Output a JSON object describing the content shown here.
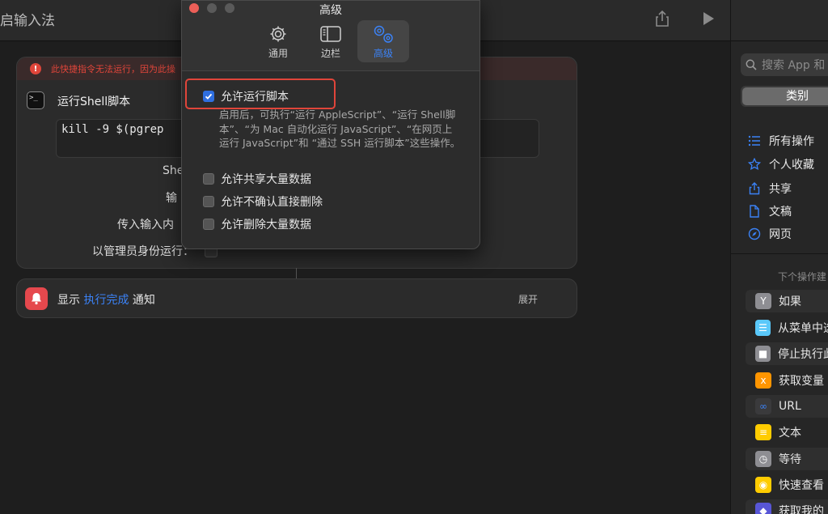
{
  "window": {
    "title": "启输入法"
  },
  "toolbar": {
    "share_icon": "share-icon",
    "run_icon": "play-icon"
  },
  "error": {
    "message": "此快捷指令无法运行，因为此操"
  },
  "shell_action": {
    "title": "运行Shell脚本",
    "code": "kill -9 $(pgrep",
    "labels": {
      "shell": "Shel",
      "input": "输",
      "pass_input": "传入输入内",
      "run_as_admin": "以管理员身份运行："
    }
  },
  "notify_action": {
    "prefix": "显示",
    "variable": "执行完成",
    "suffix": "通知",
    "expand": "展开"
  },
  "popover": {
    "title": "高级",
    "tabs": [
      {
        "label": "通用",
        "icon": "gear-icon"
      },
      {
        "label": "边栏",
        "icon": "sidebar-icon"
      },
      {
        "label": "高级",
        "icon": "gears-icon",
        "active": true
      }
    ],
    "options": [
      {
        "label": "允许运行脚本",
        "checked": true
      },
      {
        "label": "允许共享大量数据",
        "checked": false
      },
      {
        "label": "允许不确认直接删除",
        "checked": false
      },
      {
        "label": "允许删除大量数据",
        "checked": false
      }
    ],
    "description": "启用后，可执行“运行 AppleScript”、“运行 Shell脚本”、“为 Mac 自动化运行 JavaScript”、“在网页上运行 JavaScript”和 “通过 SSH 运行脚本”这些操作。"
  },
  "sidebar": {
    "search_placeholder": "搜索 App 和",
    "segment_active": "类别",
    "categories": [
      {
        "label": "所有操作",
        "icon": "list-icon"
      },
      {
        "label": "个人收藏",
        "icon": "star-icon"
      },
      {
        "label": "共享",
        "icon": "share-icon"
      },
      {
        "label": "文稿",
        "icon": "document-icon"
      },
      {
        "label": "网页",
        "icon": "compass-icon"
      }
    ],
    "suggestions_header": "下个操作建",
    "suggestions": [
      {
        "label": "如果",
        "icon": "branch-icon",
        "color": "#8e8e93"
      },
      {
        "label": "从菜单中选",
        "icon": "menu-icon",
        "color": "#5ac8fa"
      },
      {
        "label": "停止执行此",
        "icon": "stop-icon",
        "color": "#8e8e93"
      },
      {
        "label": "获取变量",
        "icon": "variable-icon",
        "color": "#ff9500"
      },
      {
        "label": "URL",
        "icon": "link-icon",
        "color": "#3a3a3c"
      },
      {
        "label": "文本",
        "icon": "text-icon",
        "color": "#ffcc00"
      },
      {
        "label": "等待",
        "icon": "clock-icon",
        "color": "#8e8e93"
      },
      {
        "label": "快速查看",
        "icon": "eye-icon",
        "color": "#ffcc00"
      },
      {
        "label": "获取我的",
        "icon": "shortcut-icon",
        "color": "#5856d6"
      }
    ]
  }
}
